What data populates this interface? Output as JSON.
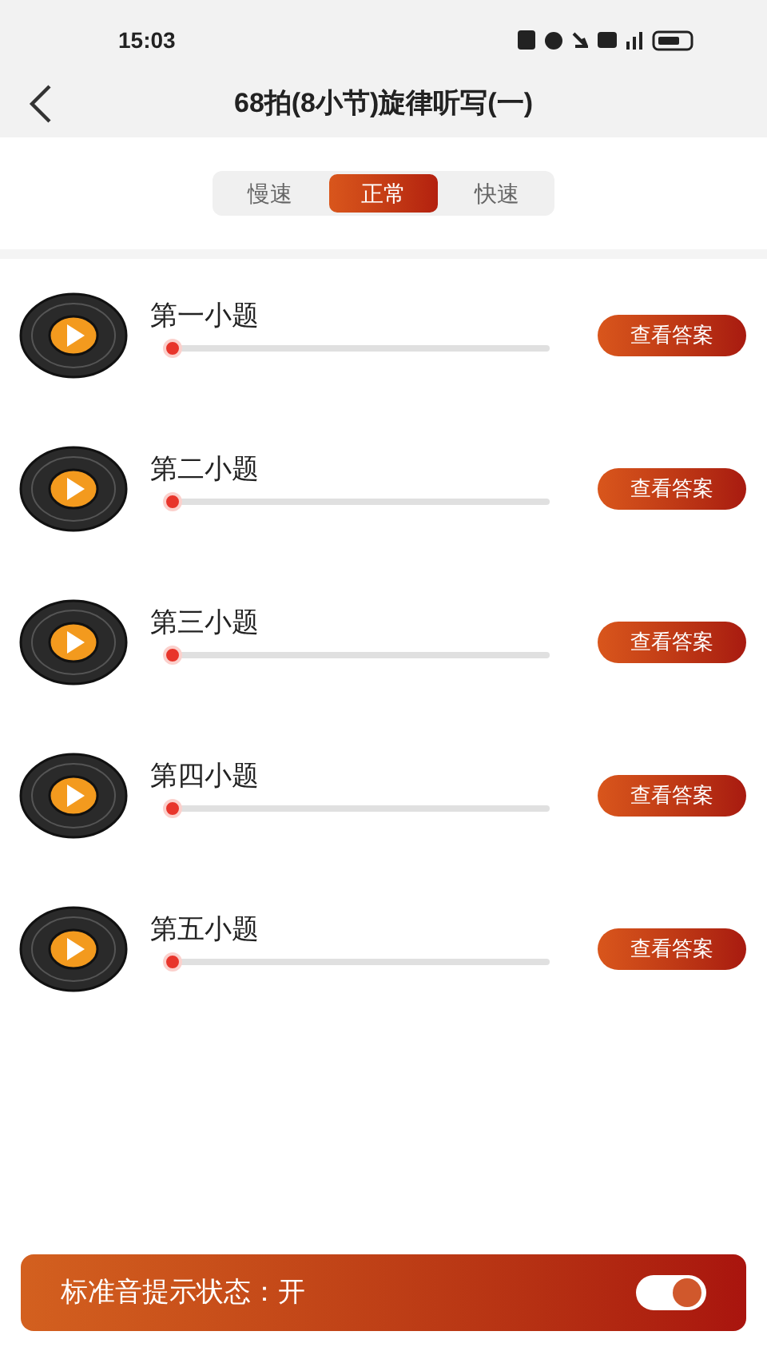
{
  "status_bar": {
    "time": "15:03"
  },
  "header": {
    "title": "68拍(8小节)旋律听写(一)"
  },
  "speed_tabs": [
    {
      "label": "慢速",
      "selected": false
    },
    {
      "label": "正常",
      "selected": true
    },
    {
      "label": "快速",
      "selected": false
    }
  ],
  "questions": [
    {
      "title": "第一小题",
      "level": 0,
      "button": "查看答案"
    },
    {
      "title": "第二小题",
      "level": 0,
      "button": "查看答案"
    },
    {
      "title": "第三小题",
      "level": 0,
      "button": "查看答案"
    },
    {
      "title": "第四小题",
      "level": 0,
      "button": "查看答案"
    },
    {
      "title": "第五小题",
      "level": 0,
      "button": "查看答案"
    }
  ],
  "footer": {
    "label": "标准音提示状态：",
    "value": "开",
    "on": true
  }
}
